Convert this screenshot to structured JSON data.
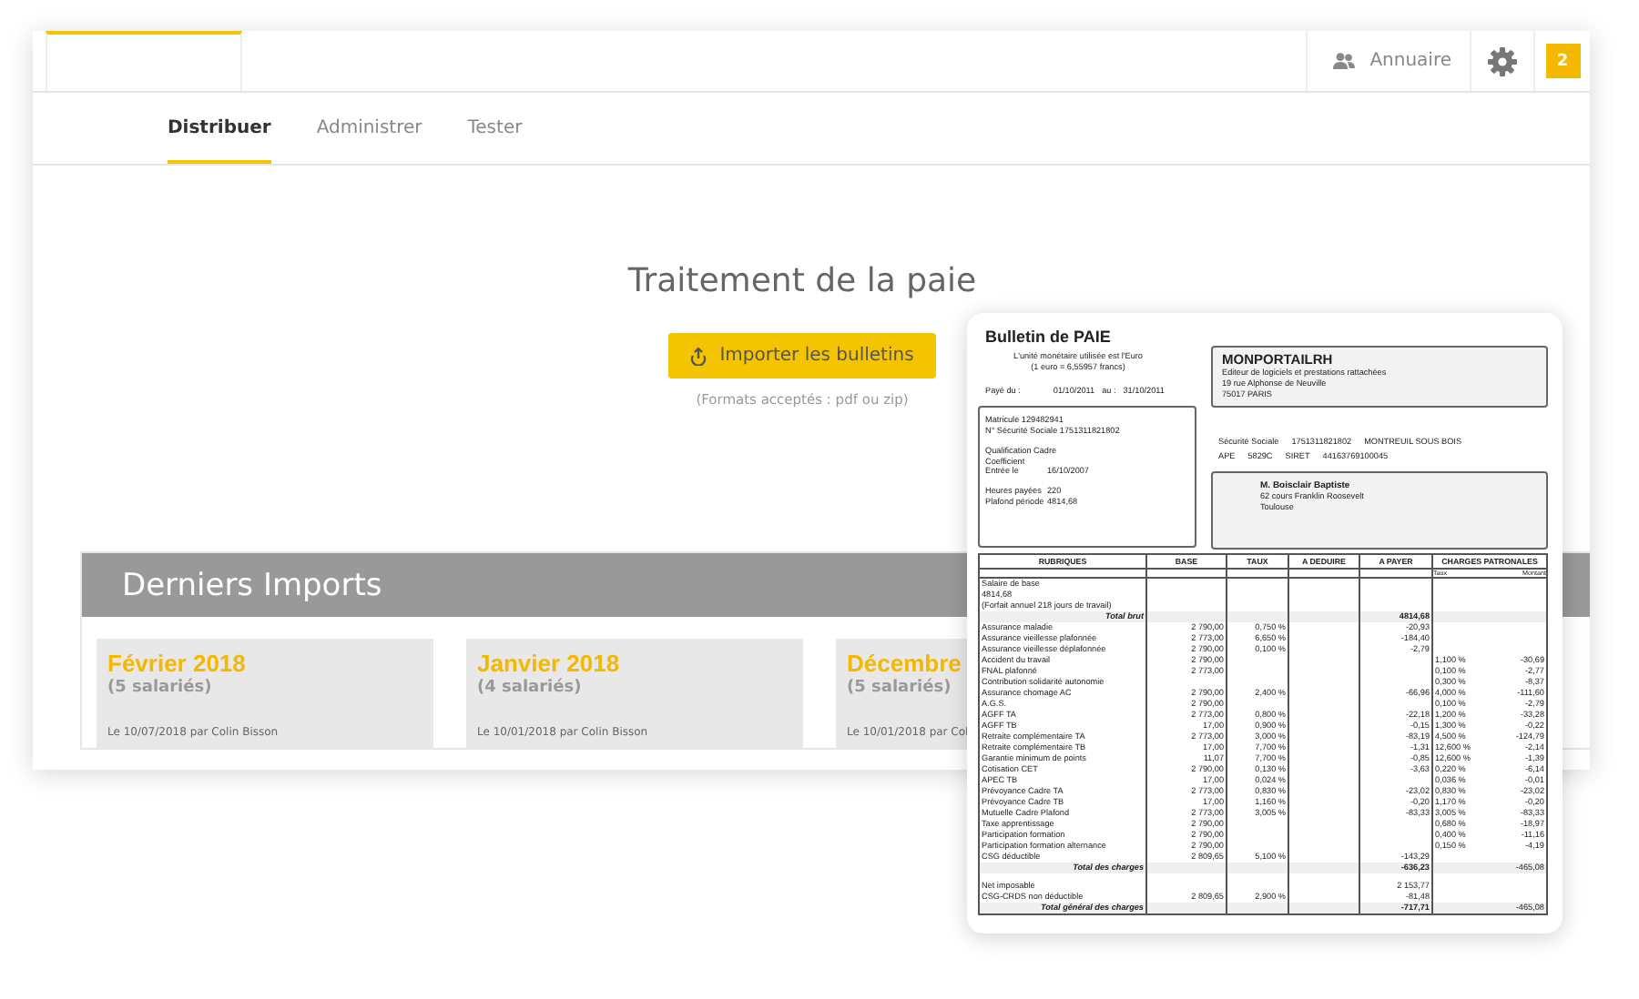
{
  "topbar": {
    "directory_label": "Annuaire",
    "notification_count": "2"
  },
  "tabs": [
    {
      "label": "Distribuer",
      "selected": true
    },
    {
      "label": "Administrer",
      "selected": false
    },
    {
      "label": "Tester",
      "selected": false
    }
  ],
  "main": {
    "title": "Traitement de la paie",
    "import_button": "Importer les bulletins",
    "formats_hint": "(Formats acceptés : pdf ou zip)"
  },
  "recent_imports": {
    "title": "Derniers Imports",
    "cards": [
      {
        "period": "Février 2018",
        "count": "(5 salariés)",
        "footer": "Le 10/07/2018 par Colin Bisson"
      },
      {
        "period": "Janvier 2018",
        "count": "(4 salariés)",
        "footer": "Le 10/01/2018 par Colin Bisson"
      },
      {
        "period": "Décembre",
        "count": "(5 salariés)",
        "footer": "Le 10/01/2018 par Col"
      }
    ]
  },
  "payslip": {
    "title": "Bulletin de PAIE",
    "currency_note": [
      "L'unité monétaire utilisée est l'Euro",
      "(1 euro = 6,55957 francs)"
    ],
    "period": {
      "from_label": "Payé du :",
      "from": "01/10/2011",
      "to_label": "au :",
      "to": "31/10/2011"
    },
    "employer": {
      "name": "MONPORTAILRH",
      "lines": [
        "Editeur de logiciels et prestations rattachées",
        "19 rue Alphonse de Neuville",
        "75017 PARIS"
      ]
    },
    "employee_groups": [
      [
        {
          "label": "Matricule 129482941"
        },
        {
          "label": "N° Sécurité Sociale 1751311821802"
        }
      ],
      [
        {
          "label": "Qualification Cadre"
        },
        {
          "label": "Coefficient"
        },
        {
          "label": "Entrée le",
          "value": "16/10/2007"
        }
      ],
      [
        {
          "label": "Heures payées",
          "value": "220"
        },
        {
          "label": "Plafond période",
          "value": "4814,68"
        }
      ]
    ],
    "registration_lines": [
      [
        "Sécurité Sociale",
        "1751311821802",
        "MONTREUIL SOUS BOIS"
      ],
      [
        "APE",
        "5829C",
        "SIRET",
        "44163769100045"
      ]
    ],
    "recipient": {
      "name": "M. Boisclair Baptiste",
      "lines": [
        "62 cours Franklin Roosevelt",
        "Toulouse"
      ]
    },
    "columns": [
      "RUBRIQUES",
      "BASE",
      "TAUX",
      "A DEDUIRE",
      "A PAYER",
      "CHARGES PATRONALES"
    ],
    "employer_subcolumns": [
      "Taux",
      "Montant"
    ],
    "rows": [
      {
        "kind": "line",
        "label": "Salaire de base"
      },
      {
        "kind": "line",
        "label": "4814,68"
      },
      {
        "kind": "line",
        "label": "(Forfait annuel 218 jours de travail)"
      },
      {
        "kind": "total",
        "label": "Total brut",
        "pay": "4814,68"
      },
      {
        "kind": "line",
        "label": "Assurance maladie",
        "base": "2 790,00",
        "rate": "0,750 %",
        "pay": "-20,93"
      },
      {
        "kind": "line",
        "label": "Assurance vieillesse plafonnée",
        "base": "2 773,00",
        "rate": "6,650 %",
        "pay": "-184,40"
      },
      {
        "kind": "line",
        "label": "Assurance vieillesse déplafonnée",
        "base": "2 790,00",
        "rate": "0,100 %",
        "pay": "-2,79"
      },
      {
        "kind": "line",
        "label": "Accident du travail",
        "base": "2 790,00",
        "employer_rate": "1,100 %",
        "employer_amount": "-30,69"
      },
      {
        "kind": "line",
        "label": "FNAL plafonné",
        "base": "2 773,00",
        "employer_rate": "0,100 %",
        "employer_amount": "-2,77"
      },
      {
        "kind": "line",
        "label": "Contribution solidarité autonomie",
        "employer_rate": "0,300 %",
        "employer_amount": "-8,37"
      },
      {
        "kind": "line",
        "label": "Assurance chomage AC",
        "base": "2 790,00",
        "rate": "2,400 %",
        "pay": "-66,96",
        "employer_rate": "4,000 %",
        "employer_amount": "-111,60"
      },
      {
        "kind": "line",
        "label": "A.G.S.",
        "base": "2 790,00",
        "employer_rate": "0,100 %",
        "employer_amount": "-2,79"
      },
      {
        "kind": "line",
        "label": "AGFF TA",
        "base": "2 773,00",
        "rate": "0,800 %",
        "pay": "-22,18",
        "employer_rate": "1,200 %",
        "employer_amount": "-33,28"
      },
      {
        "kind": "line",
        "label": "AGFF TB",
        "base": "17,00",
        "rate": "0,900 %",
        "pay": "-0,15",
        "employer_rate": "1,300 %",
        "employer_amount": "-0,22"
      },
      {
        "kind": "line",
        "label": "Retraite complémentaire TA",
        "base": "2 773,00",
        "rate": "3,000 %",
        "pay": "-83,19",
        "employer_rate": "4,500 %",
        "employer_amount": "-124,79"
      },
      {
        "kind": "line",
        "label": "Retraite complémentaire TB",
        "base": "17,00",
        "rate": "7,700 %",
        "pay": "-1,31",
        "employer_rate": "12,600 %",
        "employer_amount": "-2,14"
      },
      {
        "kind": "line",
        "label": "Garantie minimum de points",
        "base": "11,07",
        "rate": "7,700 %",
        "pay": "-0,85",
        "employer_rate": "12,600 %",
        "employer_amount": "-1,39"
      },
      {
        "kind": "line",
        "label": "Cotisation CET",
        "base": "2 790,00",
        "rate": "0,130 %",
        "pay": "-3,63",
        "employer_rate": "0,220 %",
        "employer_amount": "-6,14"
      },
      {
        "kind": "line",
        "label": "APEC TB",
        "base": "17,00",
        "rate": "0,024 %",
        "employer_rate": "0,036 %",
        "employer_amount": "-0,01"
      },
      {
        "kind": "line",
        "label": "Prévoyance Cadre TA",
        "base": "2 773,00",
        "rate": "0,830 %",
        "pay": "-23,02",
        "employer_rate": "0,830 %",
        "employer_amount": "-23,02"
      },
      {
        "kind": "line",
        "label": "Prévoyance Cadre TB",
        "base": "17,00",
        "rate": "1,160 %",
        "pay": "-0,20",
        "employer_rate": "1,170 %",
        "employer_amount": "-0,20"
      },
      {
        "kind": "line",
        "label": "Mutuelle Cadre Plafond",
        "base": "2 773,00",
        "rate": "3,005 %",
        "pay": "-83,33",
        "employer_rate": "3,005 %",
        "employer_amount": "-83,33"
      },
      {
        "kind": "line",
        "label": "Taxe apprentissage",
        "base": "2 790,00",
        "employer_rate": "0,680 %",
        "employer_amount": "-18,97"
      },
      {
        "kind": "line",
        "label": "Participation formation",
        "base": "2 790,00",
        "employer_rate": "0,400 %",
        "employer_amount": "-11,16"
      },
      {
        "kind": "line",
        "label": "Participation formation alternance",
        "base": "2 790,00",
        "employer_rate": "0,150 %",
        "employer_amount": "-4,19"
      },
      {
        "kind": "line",
        "label": "CSG déductible",
        "base": "2 809,65",
        "rate": "5,100 %",
        "pay": "-143,29"
      },
      {
        "kind": "total",
        "label": "Total des charges",
        "pay": "-636,23",
        "employer_amount": "-465,08"
      },
      {
        "kind": "spaced",
        "label": "Net imposable",
        "pay": "2 153,77"
      },
      {
        "kind": "line",
        "label": "CSG-CRDS non déductible",
        "base": "2 809,65",
        "rate": "2,900 %",
        "pay": "-81,48"
      },
      {
        "kind": "total",
        "label": "Total général des charges",
        "pay": "-717,71",
        "employer_amount": "-465,08"
      }
    ]
  }
}
